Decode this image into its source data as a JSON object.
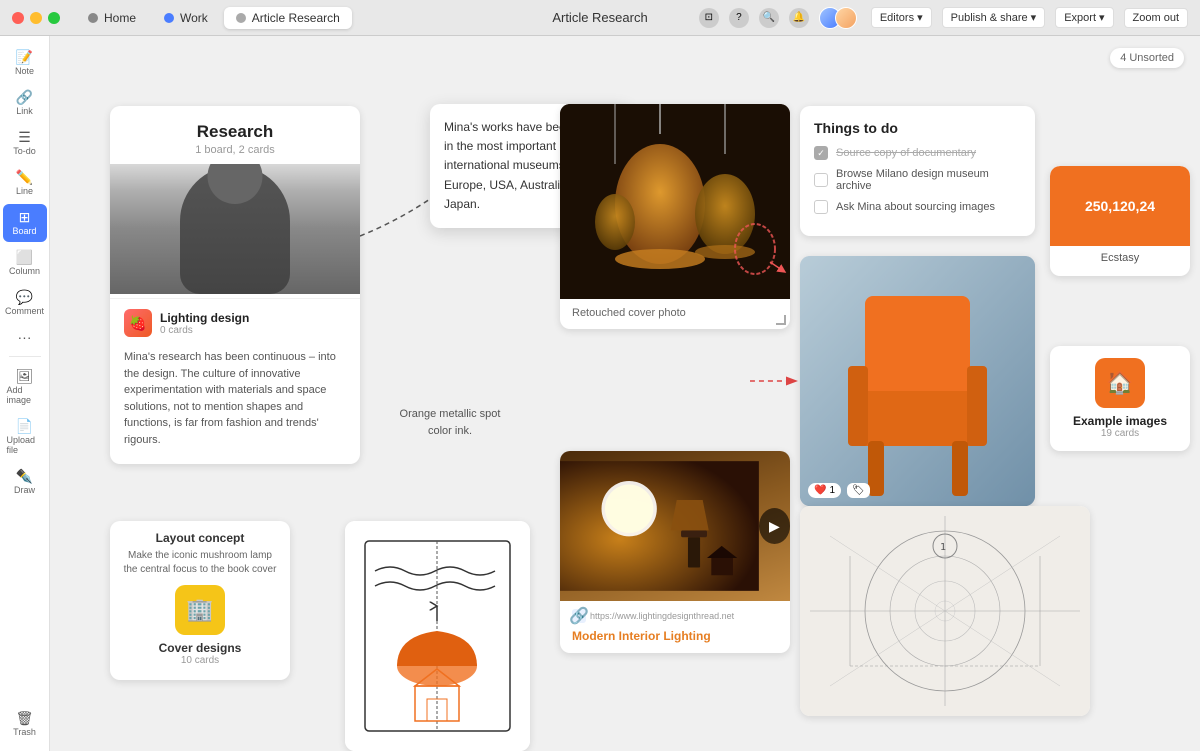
{
  "titleBar": {
    "appName": "Article Research",
    "tabs": [
      {
        "label": "Home",
        "icon": "home",
        "active": false
      },
      {
        "label": "Work",
        "icon": "work",
        "active": false
      },
      {
        "label": "Article Research",
        "icon": "doc",
        "active": true
      }
    ],
    "title": "Article Research",
    "editors": "Editors",
    "publishShare": "Publish & share",
    "export": "Export",
    "zoomOut": "Zoom out"
  },
  "sidebar": {
    "items": [
      {
        "label": "Note",
        "icon": "📝"
      },
      {
        "label": "Link",
        "icon": "🔗"
      },
      {
        "label": "To-do",
        "icon": "☰"
      },
      {
        "label": "Line",
        "icon": "✏️"
      },
      {
        "label": "Board",
        "icon": "⊞",
        "active": true
      },
      {
        "label": "Column",
        "icon": "⬜"
      },
      {
        "label": "Comment",
        "icon": "💬"
      },
      {
        "label": "•••",
        "icon": "···"
      },
      {
        "label": "Add image",
        "icon": "🖼"
      },
      {
        "label": "Upload file",
        "icon": "📄"
      },
      {
        "label": "Draw",
        "icon": "✒️"
      },
      {
        "label": "Trash",
        "icon": "🗑",
        "bottom": true
      }
    ]
  },
  "canvas": {
    "unsortedBadge": "4 Unsorted",
    "researchCard": {
      "title": "Research",
      "subtitle": "1 board, 2 cards",
      "lightingDesign": {
        "title": "Lighting design",
        "subtitle": "0 cards"
      },
      "bodyText": "Mina's research has been continuous – into the design. The culture of innovative experimentation with materials and space solutions, not to mention shapes and functions, is far from fashion and trends' rigours."
    },
    "tooltipCard": {
      "text": "Mina's works have been shown in the most important international museums in Europe, USA, Australia and Japan."
    },
    "lampCard": {
      "caption": "Retouched cover photo"
    },
    "orangeNote": {
      "text": "Orange metallic spot color ink."
    },
    "videoCard": {
      "url": "https://www.lightingdesignthread.net",
      "title": "Modern Interior Lighting"
    },
    "todoCard": {
      "title": "Things to do",
      "items": [
        {
          "text": "Source copy of documentary",
          "done": true
        },
        {
          "text": "Browse Milano design museum archive",
          "done": false
        },
        {
          "text": "Ask Mina about sourcing images",
          "done": false
        }
      ]
    },
    "swatchCard": {
      "value": "250,120,24",
      "name": "Ecstasy"
    },
    "exampleCard": {
      "title": "Example images",
      "count": "19 cards"
    },
    "layoutCard": {
      "title": "Layout concept",
      "body": "Make the iconic mushroom lamp the central focus to the book cover"
    },
    "coverCard": {
      "title": "Cover designs",
      "count": "10 cards"
    }
  }
}
